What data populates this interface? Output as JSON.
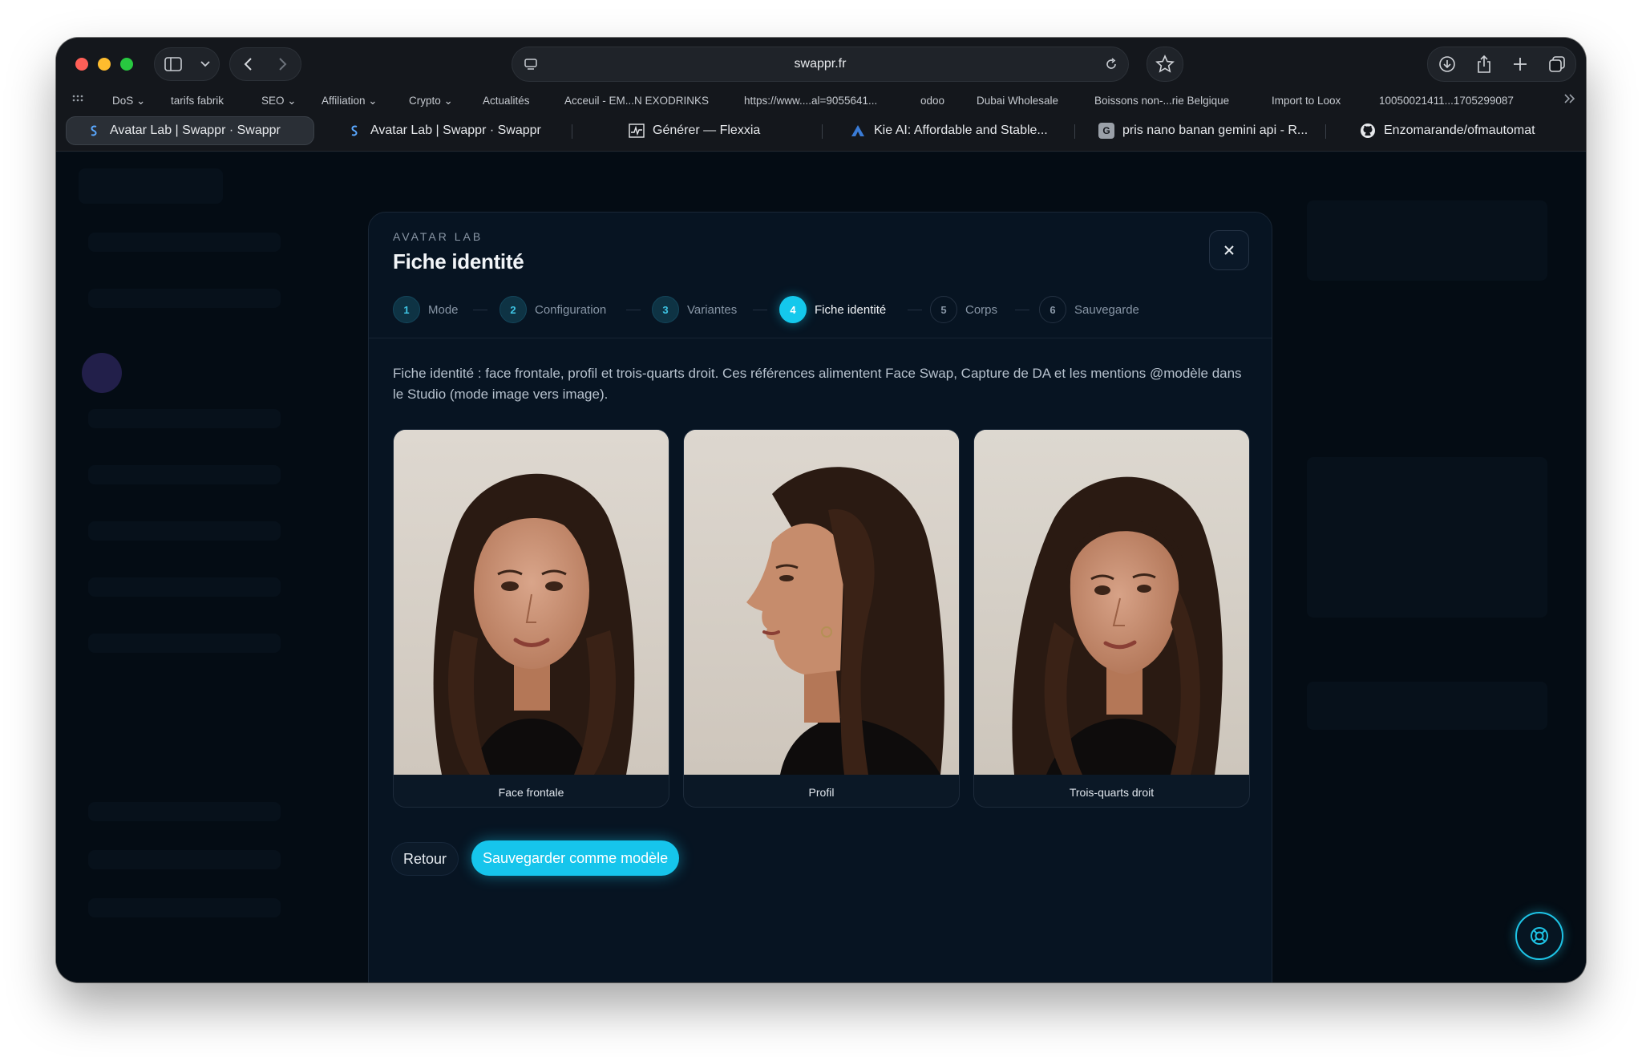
{
  "browser": {
    "url": "swappr.fr",
    "bookmarks": [
      "DoS",
      "tarifs fabrik",
      "SEO",
      "Affiliation",
      "Crypto",
      "Actualités",
      "Acceuil - EM...N EXODRINKS",
      "https://www....al=9055641...",
      "odoo",
      "Dubai Wholesale",
      "Boissons non-...rie Belgique",
      "Import to Loox",
      "10050021411...1705299087"
    ],
    "tabs": [
      {
        "label": "Avatar Lab | Swappr · Swappr"
      },
      {
        "label": "Avatar Lab | Swappr · Swappr"
      },
      {
        "label": "Générer — Flexxia"
      },
      {
        "label": "Kie AI: Affordable and Stable..."
      },
      {
        "label": "pris nano banan gemini api - R..."
      },
      {
        "label": "Enzomarande/ofmautomat"
      }
    ]
  },
  "modal": {
    "eyebrow": "AVATAR LAB",
    "title": "Fiche identité",
    "steps": [
      {
        "num": "1",
        "label": "Mode"
      },
      {
        "num": "2",
        "label": "Configuration"
      },
      {
        "num": "3",
        "label": "Variantes"
      },
      {
        "num": "4",
        "label": "Fiche identité"
      },
      {
        "num": "5",
        "label": "Corps"
      },
      {
        "num": "6",
        "label": "Sauvegarde"
      }
    ],
    "description": "Fiche identité : face frontale, profil et trois-quarts droit. Ces références alimentent Face Swap, Capture de DA et les mentions @modèle dans le Studio (mode image vers image).",
    "cards": [
      {
        "caption": "Face frontale"
      },
      {
        "caption": "Profil"
      },
      {
        "caption": "Trois-quarts droit"
      }
    ],
    "back_label": "Retour",
    "save_label": "Sauvegarder comme modèle"
  },
  "colors": {
    "accent": "#16c5ec",
    "background": "#040c14",
    "modal": "#071422"
  }
}
